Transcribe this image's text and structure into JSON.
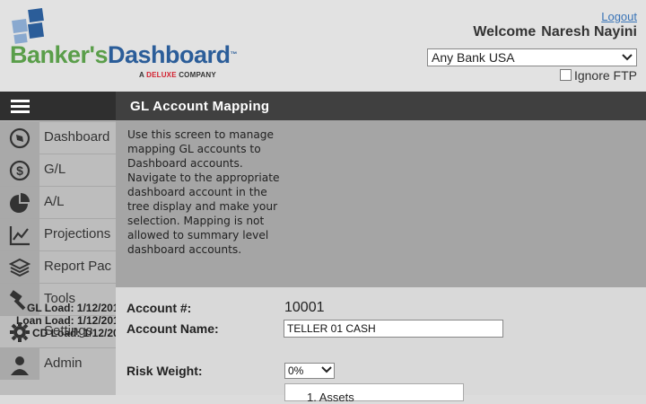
{
  "brand": {
    "name_part1": "Banker's",
    "name_part2": "Dashboard",
    "trademark": "™",
    "tagline_prefix": "A ",
    "tagline_brand": "DELUXE",
    "tagline_suffix": " COMPANY"
  },
  "header": {
    "logout_label": "Logout",
    "welcome_label": "Welcome",
    "user_name": "Naresh Nayini",
    "bank_selected": "Any Bank USA",
    "ignore_ftp_label": "Ignore FTP"
  },
  "sidebar": {
    "items": [
      {
        "label": "Dashboard",
        "icon": "compass-icon"
      },
      {
        "label": "G/L",
        "icon": "dollar-icon"
      },
      {
        "label": "A/L",
        "icon": "pie-chart-icon"
      },
      {
        "label": "Projections",
        "icon": "line-chart-icon"
      },
      {
        "label": "Report Pac",
        "icon": "layers-icon"
      },
      {
        "label": "Tools",
        "icon": "hammer-icon"
      },
      {
        "label": "Settings",
        "icon": "gear-icon"
      },
      {
        "label": "Admin",
        "icon": "user-icon"
      }
    ],
    "loads": [
      {
        "label": "GL Load: 1/12/201"
      },
      {
        "label": "Loan Load: 1/12/201"
      },
      {
        "label": "CD Load: 1/12/201"
      }
    ]
  },
  "main": {
    "title": "GL Account Mapping",
    "description": "Use this screen to manage mapping GL accounts to Dashboard accounts. Navigate to the appropriate dashboard account in the tree display and make your selection. Mapping is not allowed to summary level dashboard accounts.",
    "account_number_label": "Account #:",
    "account_number": "10001",
    "account_name_label": "Account Name:",
    "account_name": "TELLER 01 CASH",
    "risk_weight_label": "Risk Weight:",
    "risk_weight": "0%",
    "tree_first_item": "1. Assets"
  },
  "colors": {
    "brand_green": "#5a9e4a",
    "brand_blue": "#2b5d99",
    "title_bar": "#404040",
    "deluxe_red": "#d3202f"
  }
}
